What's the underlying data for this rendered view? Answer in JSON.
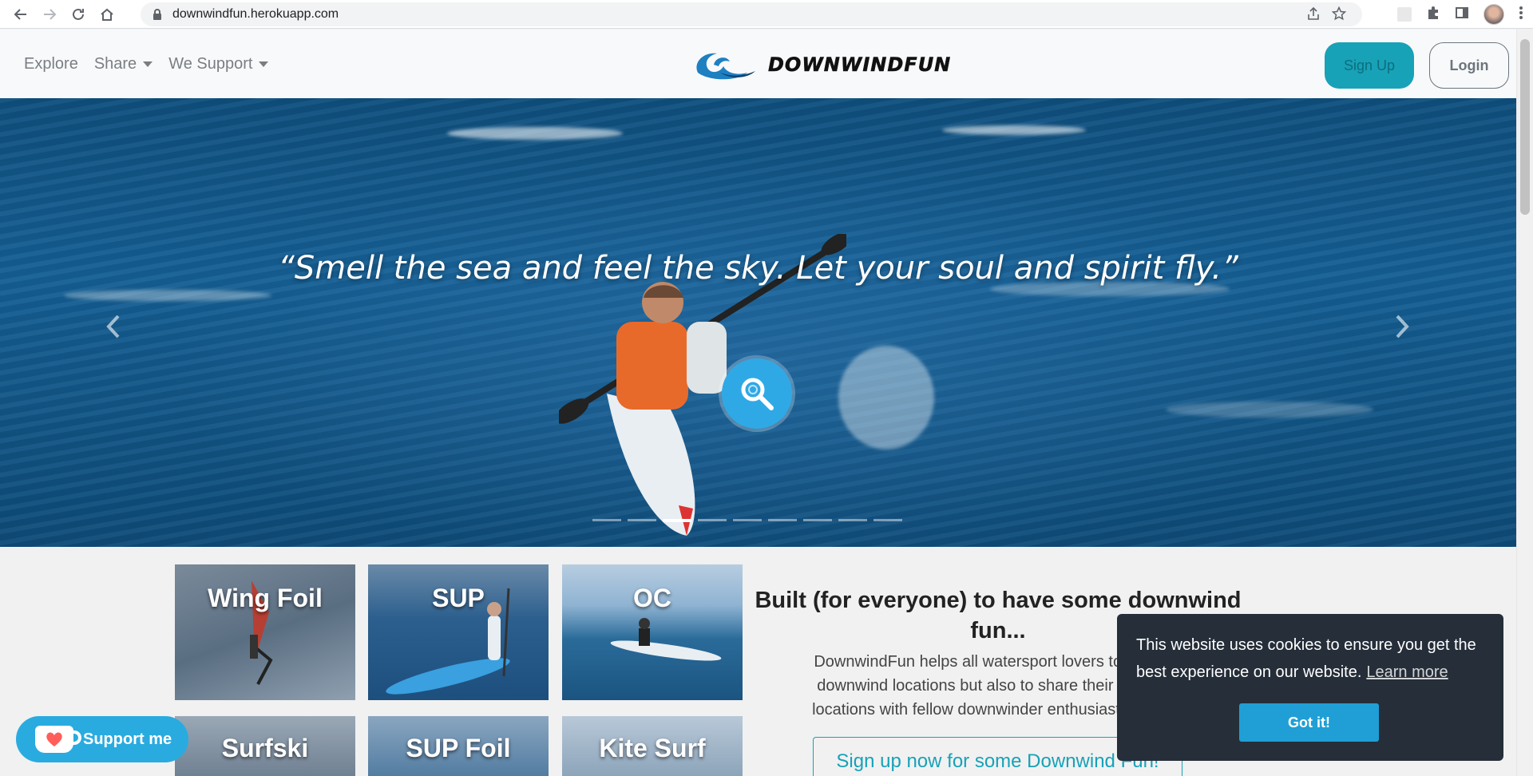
{
  "browser": {
    "url": "downwindfun.herokuapp.com"
  },
  "nav": {
    "explore": "Explore",
    "share": "Share",
    "we_support": "We Support",
    "brand": "DOWNWINDFUN",
    "sign_up": "Sign Up",
    "login": "Login"
  },
  "hero": {
    "quote": "“Smell the sea and feel the sky. Let your soul and spirit fly.”",
    "slides": 9,
    "active_slide": 3
  },
  "cards": [
    {
      "title": "Wing Foil"
    },
    {
      "title": "SUP"
    },
    {
      "title": "OC"
    },
    {
      "title": "Surfski"
    },
    {
      "title": "SUP Foil"
    },
    {
      "title": "Kite Surf"
    }
  ],
  "intro": {
    "title": "Built (for everyone) to have some downwind fun...",
    "line1": "DownwindFun helps all watersport lovers to not only",
    "line2": "downwind locations but also to share their favourite",
    "line3": "locations with fellow downwinder enthusiasts all over",
    "cta": "Sign up now for some Downwind Fun!"
  },
  "cookie": {
    "message": "This website uses cookies to ensure you get the best experience on our website.",
    "learn_more": "Learn more",
    "button": "Got it!"
  },
  "support": {
    "label": "Support me"
  },
  "colors": {
    "accent": "#17a2b8",
    "cookie_bg": "#252e39",
    "cookie_button": "#1f9fd5",
    "support_bg": "#29abe0"
  }
}
